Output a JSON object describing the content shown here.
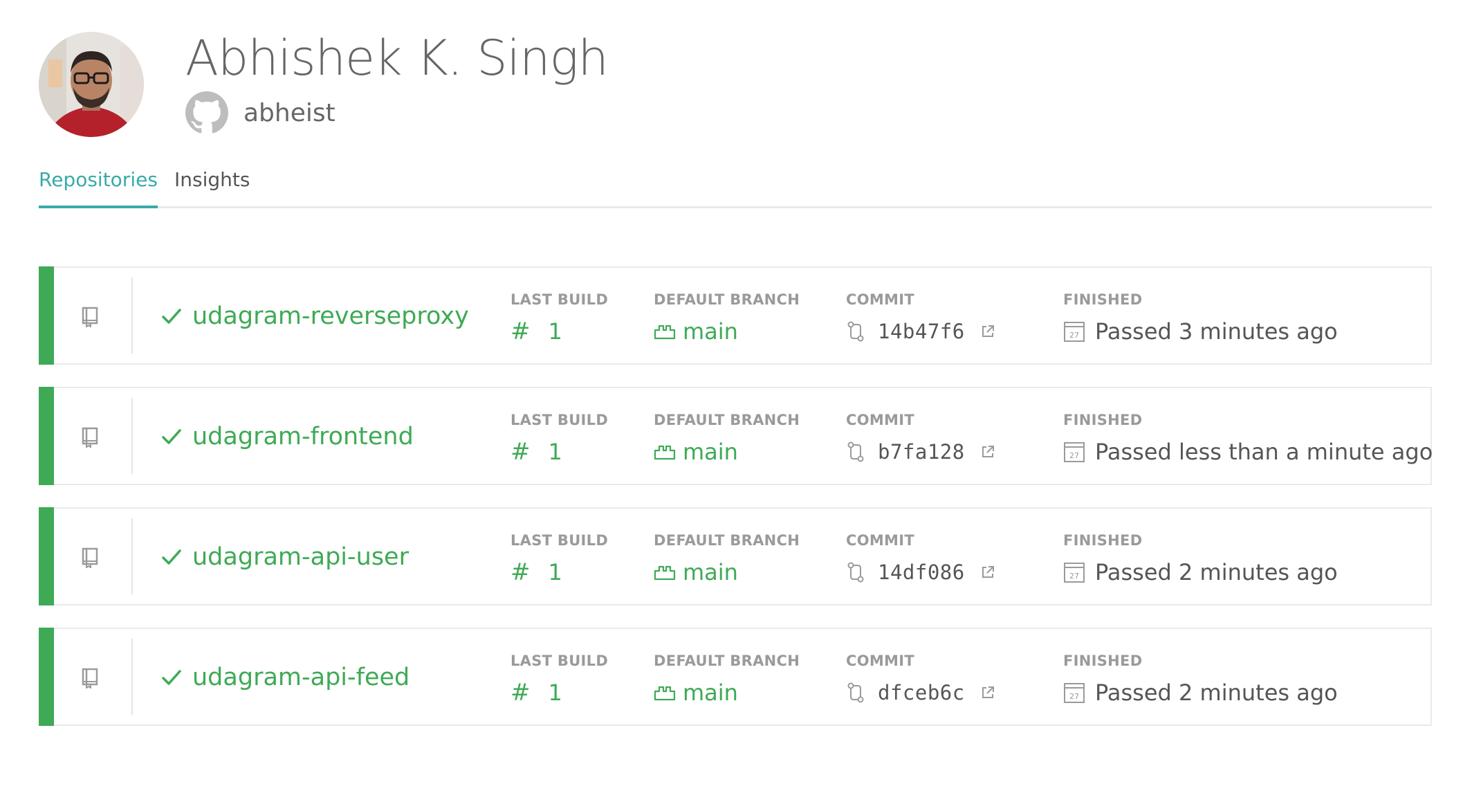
{
  "profile": {
    "name": "Abhishek K. Singh",
    "github_username": "abheist"
  },
  "tabs": [
    {
      "label": "Repositories",
      "active": true
    },
    {
      "label": "Insights",
      "active": false
    }
  ],
  "colors": {
    "passed": "#3eaa55",
    "accent": "#39aaaa"
  },
  "column_labels": {
    "last_build": "LAST BUILD",
    "default_branch": "DEFAULT BRANCH",
    "commit": "COMMIT",
    "finished": "FINISHED"
  },
  "repositories": [
    {
      "name": "udagram-reverseproxy",
      "status": "passed",
      "build_number": "1",
      "branch": "main",
      "commit": "14b47f6",
      "finished": "Passed 3 minutes ago"
    },
    {
      "name": "udagram-frontend",
      "status": "passed",
      "build_number": "1",
      "branch": "main",
      "commit": "b7fa128",
      "finished": "Passed less than a minute ago"
    },
    {
      "name": "udagram-api-user",
      "status": "passed",
      "build_number": "1",
      "branch": "main",
      "commit": "14df086",
      "finished": "Passed 2 minutes ago"
    },
    {
      "name": "udagram-api-feed",
      "status": "passed",
      "build_number": "1",
      "branch": "main",
      "commit": "dfceb6c",
      "finished": "Passed 2 minutes ago"
    }
  ]
}
